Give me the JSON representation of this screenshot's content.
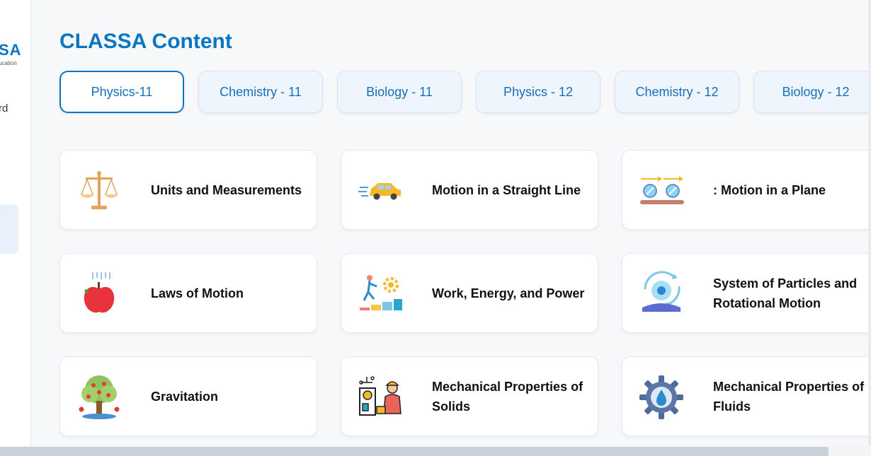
{
  "sidebar": {
    "logo_text": "SA",
    "logo_sub": "ucation",
    "item_label": "rd"
  },
  "page": {
    "title": "CLASSA Content"
  },
  "tabs": [
    {
      "label": "Physics-11",
      "active": true
    },
    {
      "label": "Chemistry - 11"
    },
    {
      "label": "Biology - 11"
    },
    {
      "label": "Physics - 12"
    },
    {
      "label": "Chemistry - 12"
    },
    {
      "label": "Biology - 12"
    }
  ],
  "chapters": [
    {
      "label": "Units and Measurements",
      "icon": "scales-icon"
    },
    {
      "label": "Motion in a Straight Line",
      "icon": "car-icon"
    },
    {
      "label": ": Motion in a Plane",
      "icon": "projectile-icon"
    },
    {
      "label": "Laws of Motion",
      "icon": "apple-icon"
    },
    {
      "label": "Work, Energy, and Power",
      "icon": "energy-icon"
    },
    {
      "label": "System of Particles and Rotational Motion",
      "icon": "rotation-icon"
    },
    {
      "label": "Gravitation",
      "icon": "apple-tree-icon"
    },
    {
      "label": "Mechanical Properties of Solids",
      "icon": "engineer-icon"
    },
    {
      "label": "Mechanical Properties of Fluids",
      "icon": "fluid-gear-icon"
    }
  ],
  "colors": {
    "accent": "#0a76c2",
    "tab_bg": "#eef5fd"
  }
}
